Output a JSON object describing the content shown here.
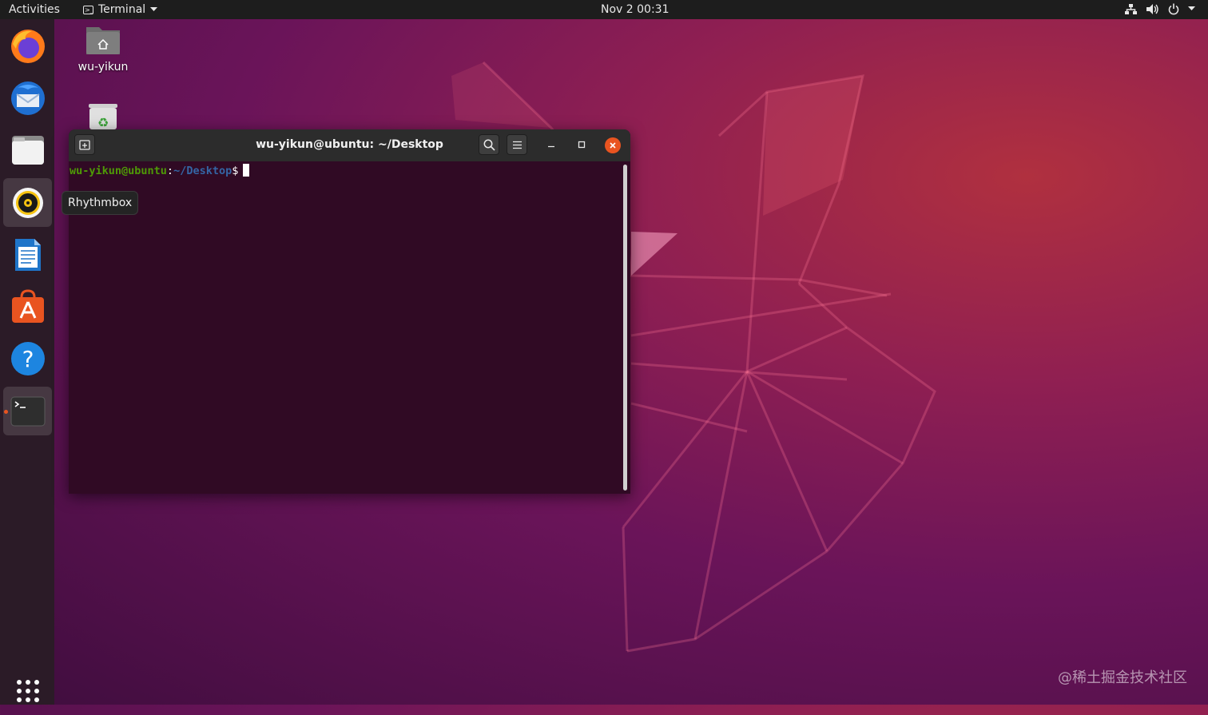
{
  "topbar": {
    "activities": "Activities",
    "app_menu": "Terminal",
    "clock": "Nov 2  00:31"
  },
  "dock": {
    "items": [
      {
        "icon": "firefox-icon"
      },
      {
        "icon": "thunderbird-icon"
      },
      {
        "icon": "files-icon"
      },
      {
        "icon": "rhythmbox-icon"
      },
      {
        "icon": "libreoffice-writer-icon"
      },
      {
        "icon": "ubuntu-software-icon"
      },
      {
        "icon": "help-icon"
      },
      {
        "icon": "terminal-icon",
        "running": true
      }
    ],
    "show_apps": "show-applications-icon"
  },
  "tooltip": "Rhythmbox",
  "desktop": {
    "home_label": "wu-yikun"
  },
  "terminal": {
    "title": "wu-yikun@ubuntu: ~/Desktop",
    "prompt_user": "wu-yikun@ubuntu",
    "prompt_sep": ":",
    "prompt_path": "~/Desktop",
    "prompt_symbol": "$"
  },
  "watermark": "@稀土掘金技术社区",
  "colors": {
    "accent": "#e95420",
    "terminal_bg": "#300a24",
    "prompt_user": "#4e9a06",
    "prompt_path": "#3465a4"
  }
}
